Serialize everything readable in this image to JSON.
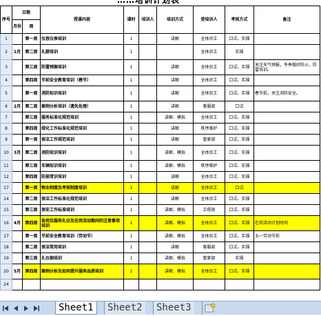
{
  "header": {
    "title": "……培训计划表",
    "col_rownum": "序号",
    "col_date": "日期",
    "col_month": "月份",
    "col_week": "周",
    "col_content": "授课内容",
    "col_hours": "课时",
    "col_trainer": "培训人",
    "col_method": "培训方式",
    "col_trainee": "受培训人",
    "col_exam": "考核方式",
    "col_remark": "备注"
  },
  "rows": [
    {
      "n": "1",
      "num": "1",
      "month": "",
      "week": "第一周",
      "content": "仪容仪表培训",
      "hours": "1",
      "method": "讲解",
      "trainee": "全体员工",
      "exam": "口试、实操",
      "remark": "",
      "hl": false
    },
    {
      "n": "2",
      "num": "2",
      "month": "1月",
      "week": "第二周",
      "content": "礼貌培训",
      "hours": "1",
      "method": "",
      "trainee": "全体员工",
      "exam": "实操",
      "remark": "",
      "hl": false
    },
    {
      "n": "3",
      "num": "3",
      "month": "",
      "week": "第三周",
      "content": "防雷预案培训",
      "hours": "1",
      "method": "讲解",
      "trainee": "全体员工",
      "exam": "口试、实操",
      "remark": "关注天气预报，冬季做好防火，防雷培训。",
      "hl": false
    },
    {
      "n": "4",
      "num": "4",
      "month": "",
      "week": "第四周",
      "content": "节前安全教育培训（春节）",
      "hours": "1",
      "method": "讲解",
      "trainee": "全体员工",
      "exam": "口试、实操",
      "remark": "",
      "hl": false
    },
    {
      "n": "5",
      "num": "5",
      "month": "",
      "week": "第一周",
      "content": "消防知识培训",
      "hours": "1",
      "method": "讲解",
      "trainee": "全体员工",
      "exam": "口试、实操",
      "remark": "春节前，关注消防安全。",
      "hl": false
    },
    {
      "n": "6",
      "num": "6",
      "month": "2月",
      "week": "第二周",
      "content": "案例分析培训（遗失处理）",
      "hours": "1",
      "method": "讲解",
      "trainee": "客服部",
      "exam": "口试",
      "remark": "",
      "hl": false
    },
    {
      "n": "7",
      "num": "7",
      "month": "",
      "week": "第三周",
      "content": "服务标准化规范培训",
      "hours": "1",
      "method": "讲解、模拟",
      "trainee": "全体员工",
      "exam": "口试、实操",
      "remark": "",
      "hl": false
    },
    {
      "n": "8",
      "num": "8",
      "month": "",
      "week": "第四周",
      "content": "绿化工作标准化规范培训",
      "hours": "1",
      "method": "讲解",
      "trainee": "秩序维护",
      "exam": "口试、实操",
      "remark": "",
      "hl": false
    },
    {
      "n": "9",
      "num": "9",
      "month": "",
      "week": "第一周",
      "content": "保洁工作规范培训",
      "hours": "1",
      "method": "讲解",
      "trainee": "管家部",
      "exam": "口试、实操",
      "remark": "",
      "hl": false
    },
    {
      "n": "10",
      "num": "10",
      "month": "3月",
      "week": "第二周",
      "content": "消防知识培训",
      "hours": "1",
      "method": "讲解、模拟",
      "trainee": "全体员工",
      "exam": "口试、实操",
      "remark": "",
      "hl": false
    },
    {
      "n": "11",
      "num": "11",
      "month": "",
      "week": "第三周",
      "content": "车辆知识培训",
      "hours": "1",
      "method": "讲解、模拟",
      "trainee": "秩序维护",
      "exam": "口试、实操",
      "remark": "",
      "hl": false
    },
    {
      "n": "12",
      "num": "12",
      "month": "",
      "week": "第四周",
      "content": "防损常识培训",
      "hours": "1",
      "method": "讲解",
      "trainee": "全体员工",
      "exam": "口试、实操",
      "remark": "",
      "hl": false
    },
    {
      "n": "17",
      "num": "13",
      "month": "",
      "week": "第一周",
      "content": "物业制度及考核制度培训",
      "hours": "1",
      "method": "讲解",
      "trainee": "全体员工",
      "exam": "口试",
      "remark": "",
      "hl": true
    },
    {
      "n": "14",
      "num": "14",
      "month": "",
      "week": "第二周",
      "content": "保洁工作标准化规范培训",
      "hours": "1",
      "method": "讲解",
      "trainee": "全体员工",
      "exam": "口试、实操",
      "remark": "",
      "hl": false
    },
    {
      "n": "15",
      "num": "15",
      "month": "",
      "week": "第三周",
      "content": "保安工作标准培训",
      "hours": "1",
      "method": "讲解、模拟",
      "trainee": "工程部",
      "exam": "口试、实操",
      "remark": "",
      "hl": false
    },
    {
      "n": "16",
      "num": "16",
      "month": "4月",
      "week": "第四周",
      "content": "各岗位服务礼仪及在岗活动期间的注意事项培训",
      "hours": "1",
      "method": "讲解、模拟",
      "trainee": "全体员工",
      "exam": "口试、实操",
      "remark": "在岗活动计划时间",
      "hl": true
    },
    {
      "n": "17",
      "num": "17",
      "month": "",
      "week": "第一周",
      "content": "节前安全教育培训（劳动节）",
      "hours": "1",
      "method": "讲解、模拟",
      "trainee": "全体员工",
      "exam": "口试、实操",
      "remark": "五一劳动节前",
      "hl": false
    },
    {
      "n": "18",
      "num": "18",
      "month": "",
      "week": "第二周",
      "content": "保洁常用培训",
      "hours": "1",
      "method": "讲解",
      "trainee": "客服部",
      "exam": "口试、实操",
      "remark": "",
      "hl": false
    },
    {
      "n": "19",
      "num": "19",
      "month": "",
      "week": "第三周",
      "content": "礼仪细培训",
      "hours": "1",
      "method": "讲解、模拟",
      "trainee": "管家部",
      "exam": "实操",
      "remark": "",
      "hl": false
    },
    {
      "n": "20",
      "num": "20",
      "month": "5月",
      "week": "第四周",
      "content": "案例分析及如何提升服务品质培训",
      "hours": "1",
      "method": "讲解、模拟",
      "trainee": "全体员工",
      "exam": "口试、实操",
      "remark": "",
      "hl": true
    },
    {
      "n": "24",
      "num": "",
      "month": "",
      "week": "",
      "content": "",
      "hours": "",
      "method": "",
      "trainee": "",
      "exam": "",
      "remark": "",
      "hl": false
    }
  ],
  "tabs": {
    "sheet1": "Sheet1",
    "sheet2": "Sheet2",
    "sheet3": "Sheet3"
  },
  "colors": {
    "highlight": "#ffff00",
    "tabbar": "#c9d9ee"
  }
}
